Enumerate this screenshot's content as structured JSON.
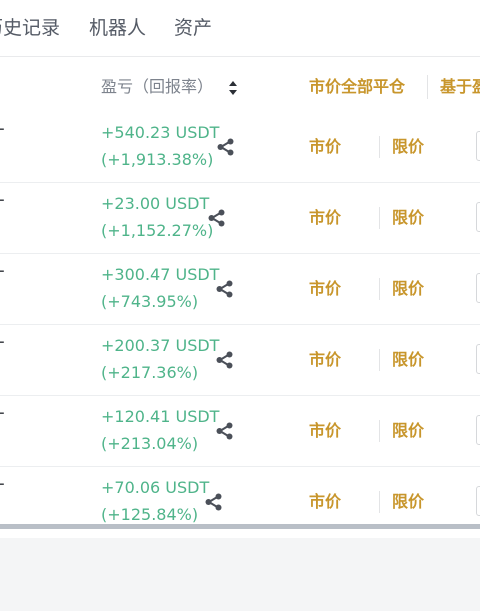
{
  "tabs": {
    "history": "历史记录",
    "robot": "机器人",
    "assets": "资产"
  },
  "header": {
    "pnl_label": "盈亏（回报率）",
    "close_all_market": "市价全部平仓",
    "based_on": "基于盈"
  },
  "row_symbol_stub": "T",
  "rows": [
    {
      "pnl": "+540.23 USDT",
      "rate": "(+1,913.38%)",
      "market": "市价",
      "limit": "限价"
    },
    {
      "pnl": "+23.00 USDT",
      "rate": "(+1,152.27%)",
      "market": "市价",
      "limit": "限价"
    },
    {
      "pnl": "+300.47 USDT",
      "rate": "(+743.95%)",
      "market": "市价",
      "limit": "限价"
    },
    {
      "pnl": "+200.37 USDT",
      "rate": "(+217.36%)",
      "market": "市价",
      "limit": "限价"
    },
    {
      "pnl": "+120.41 USDT",
      "rate": "(+213.04%)",
      "market": "市价",
      "limit": "限价"
    },
    {
      "pnl": "+70.06 USDT",
      "rate": "(+125.84%)",
      "market": "市价",
      "limit": "限价"
    }
  ],
  "icons": {
    "share": "share-icon",
    "sort": "sort-icon"
  },
  "colors": {
    "profit_green": "#4fb48a",
    "accent_gold": "#c8962c",
    "tab_gray": "#555b66",
    "header_gray": "#7d838d"
  }
}
